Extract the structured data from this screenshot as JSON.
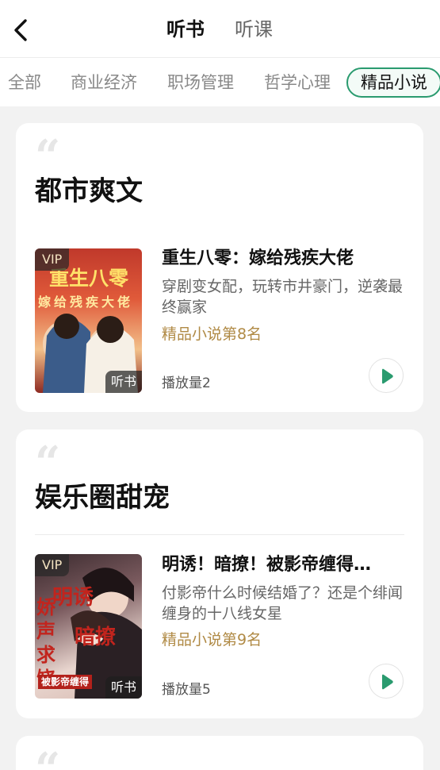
{
  "header": {
    "tabs": [
      "听书",
      "听课"
    ],
    "back_icon": "chevron-left-icon"
  },
  "categories": [
    "全部",
    "商业经济",
    "职场管理",
    "哲学心理",
    "精品小说"
  ],
  "selected_category": "精品小说",
  "colors": {
    "accent_green": "#2a9b6f",
    "rank_gold": "#b08a45",
    "page_bg": "#f2f2f2"
  },
  "cards": [
    {
      "section_title": "都市爽文",
      "book": {
        "title": "重生八零：嫁给残疾大佬",
        "description": "穿剧变女配，玩转市井豪门，逆袭最终赢家",
        "rank": "精品小说第8名",
        "plays": "播放量2",
        "vip": "VIP",
        "tag": "听书",
        "cover_text": [
          "重生八零",
          "嫁给残疾大佬"
        ]
      }
    },
    {
      "section_title": "娱乐圈甜宠",
      "book": {
        "title": "明诱！暗撩！被影帝缠得…",
        "description": "付影帝什么时候结婚了？还是个绯闻缠身的十八线女星",
        "rank": "精品小说第9名",
        "plays": "播放量5",
        "vip": "VIP",
        "tag": "听书",
        "cover_text": [
          "明诱",
          "暗撩",
          "娇声求饶",
          "被影帝缠得"
        ]
      }
    }
  ]
}
